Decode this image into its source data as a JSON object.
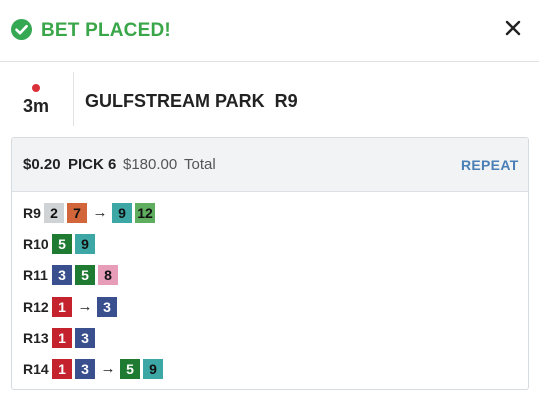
{
  "header": {
    "title": "BET PLACED!",
    "status_icon": "check-circle-icon",
    "close_icon": "close-icon",
    "accent_color": "#3aa64a"
  },
  "race": {
    "time": "3m",
    "live_indicator_color": "#d9303a",
    "track": "GULFSTREAM PARK  R9"
  },
  "bet": {
    "amount": "$0.20",
    "type": "PICK 6",
    "total_amount": "$180.00",
    "total_label": "Total",
    "repeat_label": "REPEAT"
  },
  "legs": [
    {
      "label": "R9",
      "selections": [
        {
          "text": "2",
          "color": "grey"
        },
        {
          "text": "7",
          "color": "orange"
        },
        {
          "text": "→",
          "type": "arrow"
        },
        {
          "text": "9",
          "color": "teal"
        },
        {
          "text": "12",
          "color": "lgreen"
        }
      ]
    },
    {
      "label": "R10",
      "selections": [
        {
          "text": "5",
          "color": "green"
        },
        {
          "text": "9",
          "color": "teal"
        }
      ]
    },
    {
      "label": "R11",
      "selections": [
        {
          "text": "3",
          "color": "navy"
        },
        {
          "text": "5",
          "color": "green"
        },
        {
          "text": "8",
          "color": "pink"
        }
      ]
    },
    {
      "label": "R12",
      "selections": [
        {
          "text": "1",
          "color": "red"
        },
        {
          "text": "→",
          "type": "arrow"
        },
        {
          "text": "3",
          "color": "navy"
        }
      ]
    },
    {
      "label": "R13",
      "selections": [
        {
          "text": "1",
          "color": "red"
        },
        {
          "text": "3",
          "color": "navy"
        }
      ]
    },
    {
      "label": "R14",
      "selections": [
        {
          "text": "1",
          "color": "red"
        },
        {
          "text": "3",
          "color": "navy"
        },
        {
          "text": "→",
          "type": "arrow"
        },
        {
          "text": "5",
          "color": "green"
        },
        {
          "text": "9",
          "color": "teal"
        }
      ]
    }
  ]
}
